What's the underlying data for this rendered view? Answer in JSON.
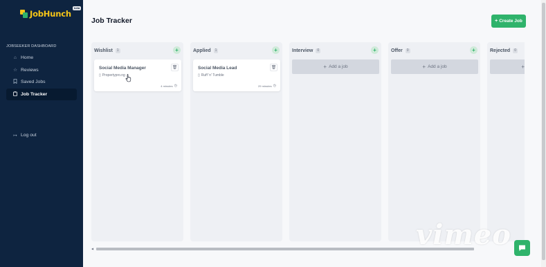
{
  "app": {
    "name": "JobHunch",
    "badge": "beta"
  },
  "sidebar": {
    "heading": "JOBSEEKER DASHBOARD",
    "items": [
      {
        "label": "Home",
        "icon": "home-icon"
      },
      {
        "label": "Reviews",
        "icon": "star-icon"
      },
      {
        "label": "Saved Jobs",
        "icon": "bookmark-icon"
      },
      {
        "label": "Job Tracker",
        "icon": "clipboard-icon",
        "active": true
      }
    ],
    "logout": {
      "label": "Log out",
      "icon": "logout-icon"
    }
  },
  "header": {
    "title": "Job Tracker",
    "create_label": "Create Job"
  },
  "board": {
    "add_job_label": "Add a job",
    "columns": [
      {
        "title": "Wishlist",
        "count": "1"
      },
      {
        "title": "Applied",
        "count": "1"
      },
      {
        "title": "Interview",
        "count": "0"
      },
      {
        "title": "Offer",
        "count": "0"
      },
      {
        "title": "Rejected",
        "count": "0"
      }
    ],
    "cards": [
      {
        "title": "Social Media Manager",
        "company": "Propertypro.ng",
        "time": "4 minutes"
      },
      {
        "title": "Social Media Lead",
        "company": "Ruff 'n' Tumble",
        "time": "29 minutes"
      }
    ]
  },
  "watermark": "vimeo",
  "colors": {
    "sidebar": "#0e2440",
    "accent": "#2fb36b",
    "logo": "#f5c518"
  }
}
